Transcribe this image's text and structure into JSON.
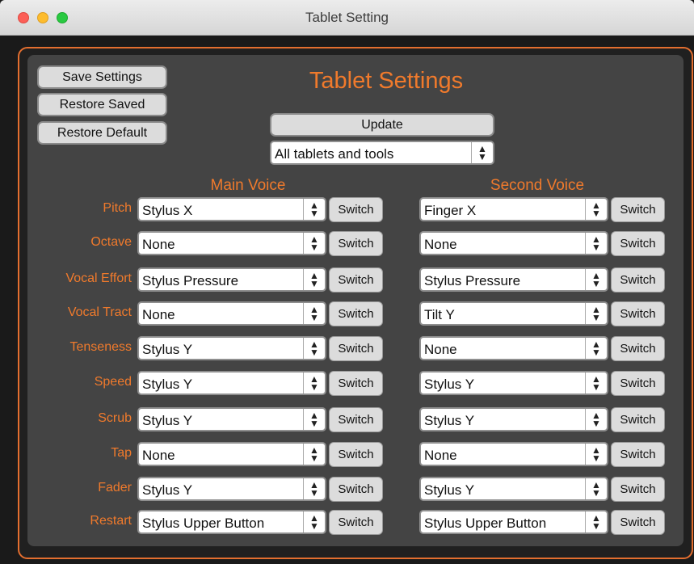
{
  "window": {
    "title": "Tablet Setting"
  },
  "panel": {
    "title": "Tablet Settings",
    "buttons": {
      "save": "Save Settings",
      "restore_saved": "Restore Saved",
      "restore_default": "Restore Default",
      "update": "Update"
    },
    "tablet_select": "All tablets and tools"
  },
  "sections": {
    "main": "Main Voice",
    "second": "Second Voice"
  },
  "switch_label": "Switch",
  "rows": [
    {
      "label": "Pitch",
      "main": "Stylus X",
      "second": "Finger X"
    },
    {
      "label": "Octave",
      "main": "None",
      "second": "None"
    },
    {
      "label": "Vocal Effort",
      "main": "Stylus Pressure",
      "second": "Stylus Pressure"
    },
    {
      "label": "Vocal Tract",
      "main": "None",
      "second": "Tilt Y"
    },
    {
      "label": "Tenseness",
      "main": "Stylus Y",
      "second": "None"
    },
    {
      "label": "Speed",
      "main": "Stylus Y",
      "second": "Stylus Y"
    },
    {
      "label": "Scrub",
      "main": "Stylus Y",
      "second": "Stylus Y"
    },
    {
      "label": "Tap",
      "main": "None",
      "second": "None"
    },
    {
      "label": "Fader",
      "main": "Stylus Y",
      "second": "Stylus Y"
    },
    {
      "label": "Restart",
      "main": "Stylus Upper Button",
      "second": "Stylus Upper Button"
    }
  ],
  "colors": {
    "accent": "#f07a2c",
    "panel": "#444444",
    "frame": "#e36e2f"
  }
}
